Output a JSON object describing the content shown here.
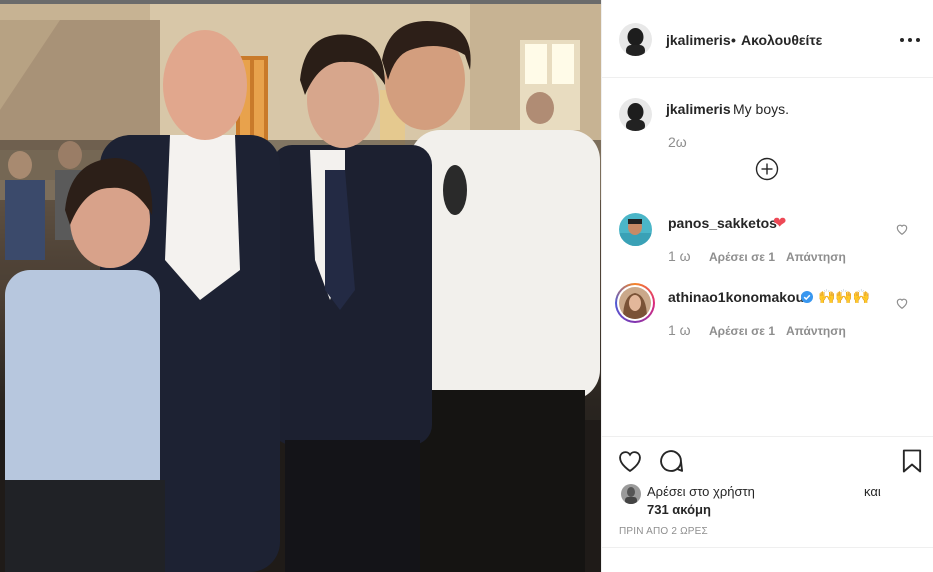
{
  "post": {
    "image_alt_name": "group-photo"
  },
  "header": {
    "username": "jkalimeris",
    "separator": "•",
    "follow_state": "Ακολουθείτε",
    "more_icon": "more-options-icon"
  },
  "caption": {
    "username": "jkalimeris",
    "text": "My boys.",
    "time": "2ω",
    "load_more_icon": "plus-circle-icon"
  },
  "comments": [
    {
      "username": "panos_sakketos",
      "emoji": "❤",
      "time": "1 ω",
      "likes": "Αρέσει σε 1",
      "reply": "Απάντηση",
      "verified": false
    },
    {
      "username": "athinao1konomakou",
      "emoji": "🙌🙌🙌",
      "time": "1 ω",
      "likes": "Αρέσει σε 1",
      "reply": "Απάντηση",
      "verified": true
    }
  ],
  "actions": {
    "like_icon": "heart-icon",
    "comment_icon": "comment-icon",
    "save_icon": "bookmark-icon"
  },
  "likes": {
    "text": "Αρέσει στο χρήστη",
    "conjunction": "και",
    "count": "731 ακόμη"
  },
  "post_time": "ΠΡΙΝ ΑΠΟ 2 ΩΡΕΣ",
  "colors": {
    "text": "#262626",
    "muted": "#8e8e8e",
    "border": "#efefef",
    "verified": "#3897f0",
    "heart_red": "#ed4956"
  }
}
